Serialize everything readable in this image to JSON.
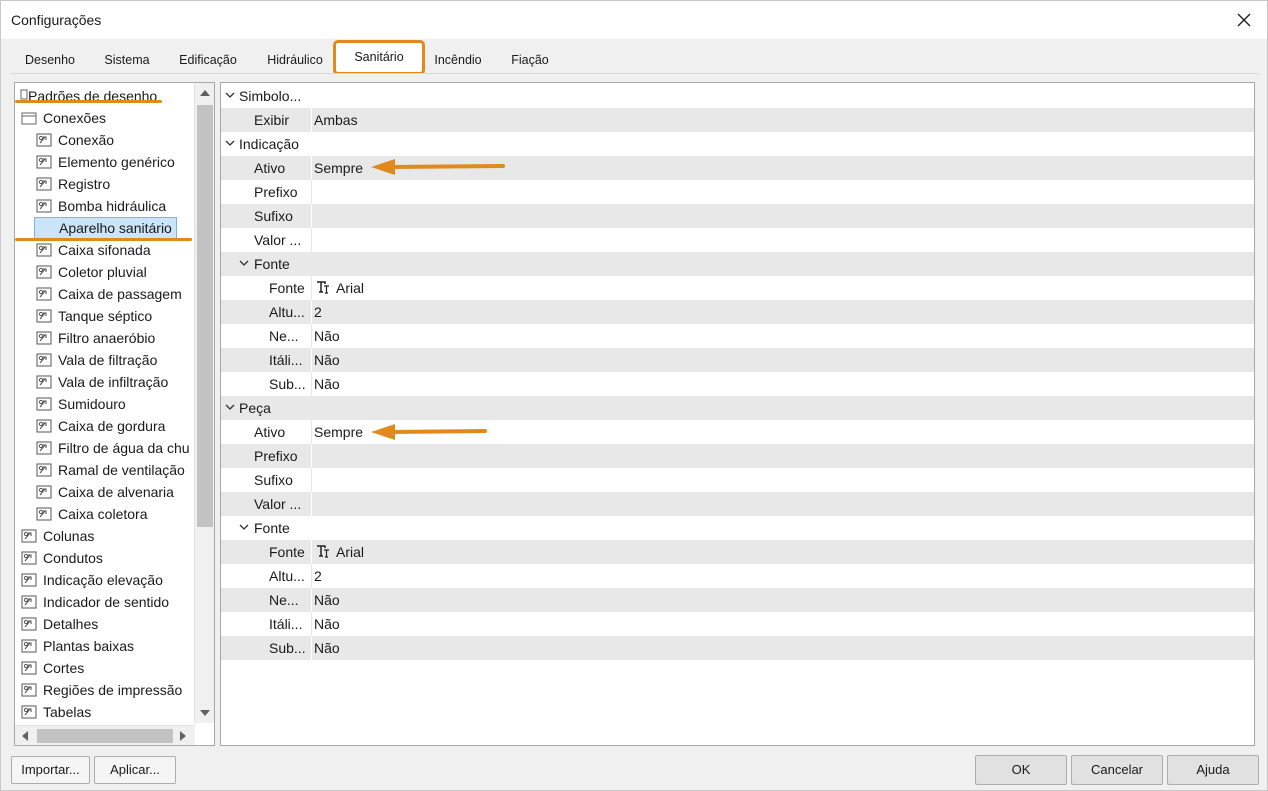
{
  "window": {
    "title": "Configurações"
  },
  "tabs": [
    {
      "label": "Desenho"
    },
    {
      "label": "Sistema"
    },
    {
      "label": "Edificação"
    },
    {
      "label": "Hidráulico"
    },
    {
      "label": "Sanitário",
      "active": true
    },
    {
      "label": "Incêndio"
    },
    {
      "label": "Fiação"
    }
  ],
  "tree": {
    "root": "Padrões de desenho",
    "group": "Conexões",
    "children": [
      "Conexão",
      "Elemento genérico",
      "Registro",
      "Bomba hidráulica",
      "Aparelho sanitário",
      "Caixa sifonada",
      "Coletor pluvial",
      "Caixa de passagem",
      "Tanque séptico",
      "Filtro anaeróbio",
      "Vala de filtração",
      "Vala de infiltração",
      "Sumidouro",
      "Caixa de gordura",
      "Filtro de água da chu",
      "Ramal de ventilação",
      "Caixa de alvenaria",
      "Caixa coletora"
    ],
    "selected": "Aparelho sanitário",
    "top_level": [
      "Colunas",
      "Condutos",
      "Indicação elevação",
      "Indicador de sentido",
      "Detalhes",
      "Plantas baixas",
      "Cortes",
      "Regiões de impressão",
      "Tabelas"
    ]
  },
  "properties": {
    "simbolo": {
      "label": "Simbolo...",
      "exibir_label": "Exibir",
      "exibir_value": "Ambas"
    },
    "indicacao": {
      "label": "Indicação",
      "ativo_label": "Ativo",
      "ativo_value": "Sempre",
      "prefixo_label": "Prefixo",
      "prefixo_value": "",
      "sufixo_label": "Sufixo",
      "sufixo_value": "",
      "valor_label": "Valor ...",
      "valor_value": "",
      "fonte_group": "Fonte",
      "fonte_label": "Fonte",
      "fonte_value": "Arial",
      "altura_label": "Altu...",
      "altura_value": "2",
      "negrito_label": "Ne...",
      "negrito_value": "Não",
      "italico_label": "Itáli...",
      "italico_value": "Não",
      "sublinhado_label": "Sub...",
      "sublinhado_value": "Não"
    },
    "peca": {
      "label": "Peça",
      "ativo_label": "Ativo",
      "ativo_value": "Sempre",
      "prefixo_label": "Prefixo",
      "prefixo_value": "",
      "sufixo_label": "Sufixo",
      "sufixo_value": "",
      "valor_label": "Valor ...",
      "valor_value": "",
      "fonte_group": "Fonte",
      "fonte_label": "Fonte",
      "fonte_value": "Arial",
      "altura_label": "Altu...",
      "altura_value": "2",
      "negrito_label": "Ne...",
      "negrito_value": "Não",
      "italico_label": "Itáli...",
      "italico_value": "Não",
      "sublinhado_label": "Sub...",
      "sublinhado_value": "Não"
    }
  },
  "buttons": {
    "importar": "Importar...",
    "aplicar": "Aplicar...",
    "ok": "OK",
    "cancelar": "Cancelar",
    "ajuda": "Ajuda"
  },
  "colors": {
    "annotation": "#e08a1e",
    "selection_bg": "#cce4f7",
    "row_alt": "#e8e8e8"
  },
  "icons": {
    "tree_item": "settings-object-icon",
    "font": "font-icon",
    "close": "close-icon"
  }
}
